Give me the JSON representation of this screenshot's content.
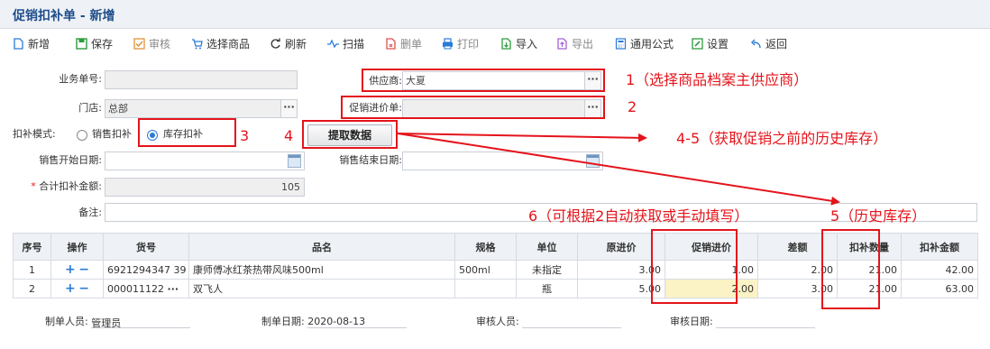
{
  "header": {
    "title": "促销扣补单 - 新增"
  },
  "toolbar": {
    "new": "新增",
    "save": "保存",
    "audit": "审核",
    "select_goods": "选择商品",
    "refresh": "刷新",
    "scan": "扫描",
    "delete_row": "删单",
    "print": "打印",
    "import": "导入",
    "export": "导出",
    "formula": "通用公式",
    "settings": "设置",
    "back": "返回"
  },
  "form": {
    "doc_no_label": "业务单号:",
    "doc_no_value": "",
    "supplier_label": "供应商:",
    "supplier_value": "大夏",
    "store_label": "门店:",
    "store_value": "总部",
    "promo_cost_doc_label": "促销进价单:",
    "promo_cost_doc_value": "",
    "mode_label": "扣补模式:",
    "mode_opt_sales": "销售扣补",
    "mode_opt_stock": "库存扣补",
    "fetch_button": "提取数据",
    "sales_start_label": "销售开始日期:",
    "sales_start_value": "",
    "sales_end_label": "销售结束日期:",
    "sales_end_value": "",
    "total_label": "合计扣补金额:",
    "total_required_mark": "*",
    "total_value": "105",
    "remark_label": "备注:",
    "remark_value": ""
  },
  "annotations": {
    "a1": "1（选择商品档案主供应商）",
    "a2": "2",
    "a3": "3",
    "a4": "4",
    "a45": "4-5（获取促销之前的历史库存）",
    "a6": "6（可根据2自动获取或手动填写）",
    "a5": "5（历史库存）",
    "color": "#e4141b"
  },
  "table": {
    "headers": [
      "序号",
      "操作",
      "货号",
      "品名",
      "规格",
      "单位",
      "原进价",
      "促销进价",
      "差额",
      "扣补数量",
      "扣补金额"
    ],
    "rows": [
      {
        "seq": "1",
        "code": "6921294347 39",
        "name": "康师傅冰红茶热带风味500ml",
        "spec": "500ml",
        "unit": "未指定",
        "orig": "3.00",
        "promo": "1.00",
        "diff": "2.00",
        "qty": "21.00",
        "amount": "42.00"
      },
      {
        "seq": "2",
        "code": "000011122",
        "name": "双飞人",
        "spec": "",
        "unit": "瓶",
        "orig": "5.00",
        "promo": "2.00",
        "diff": "3.00",
        "qty": "21.00",
        "amount": "63.00"
      }
    ]
  },
  "footer": {
    "maker_label": "制单人员:",
    "maker_value": "管理员",
    "make_date_label": "制单日期:",
    "make_date_value": "2020-08-13",
    "auditor_label": "审核人员:",
    "auditor_value": "",
    "audit_date_label": "审核日期:",
    "audit_date_value": ""
  }
}
